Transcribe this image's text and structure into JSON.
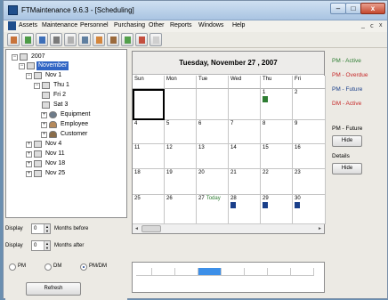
{
  "window": {
    "title": "FTMaintenance 9.6.3 - [Scheduling]"
  },
  "title_controls": {
    "minimize": "–",
    "maximize": "□",
    "close": "x"
  },
  "mdi_controls": {
    "minimize": "_",
    "restore": "ⅽ",
    "close": "x"
  },
  "menu": [
    "Assets",
    "Maintenance",
    "Personnel",
    "Purchasing",
    "Other",
    "Reports",
    "Windows",
    "Help"
  ],
  "toolbar_icons": [
    {
      "name": "work-order-icon",
      "color": "#c8733a"
    },
    {
      "name": "vendor-icon",
      "color": "#4d9b46"
    },
    {
      "name": "assets-icon",
      "color": "#3d6fb8"
    },
    {
      "name": "calendar-icon",
      "color": "#7a7a7a"
    },
    {
      "name": "inventory-icon",
      "color": "#b0b0b0"
    },
    {
      "name": "reports-icon",
      "color": "#5f7fa0"
    },
    {
      "name": "purchase-icon",
      "color": "#d4863c"
    },
    {
      "name": "people-icon",
      "color": "#9a6a3c"
    },
    {
      "name": "tools-icon",
      "color": "#53a04b"
    },
    {
      "name": "settings-icon",
      "color": "#c44f3f"
    },
    {
      "name": "help-icon",
      "color": "#cfcfcf"
    }
  ],
  "tree": {
    "year": "2007",
    "month": "November",
    "nov1": "Nov 1",
    "thu1": "Thu 1",
    "fri2": "Fri 2",
    "sat3": "Sat 3",
    "equipment": "Equipment",
    "employee": "Employee",
    "customer": "Customer",
    "nov4": "Nov 4",
    "nov11": "Nov 11",
    "nov18": "Nov 18",
    "nov25": "Nov 25",
    "expanded": "−",
    "collapsed": "+"
  },
  "months_before": {
    "label": "Display",
    "value": "0",
    "suffix": "Months before"
  },
  "months_after": {
    "label": "Display",
    "value": "0",
    "suffix": "Months after"
  },
  "filter": {
    "pm": "PM",
    "dm": "DM",
    "pmdm": "PM/DM",
    "selected": "PM/DM"
  },
  "refresh_label": "Refresh",
  "calendar": {
    "date_title": "Tuesday, November 27 , 2007",
    "days": [
      "Sun",
      "Mon",
      "Tue",
      "Wed",
      "Thu",
      "Fri"
    ],
    "today_label": "Today",
    "weeks": [
      [
        "",
        "",
        "",
        "",
        "1",
        "2"
      ],
      [
        "4",
        "5",
        "6",
        "7",
        "8",
        "9"
      ],
      [
        "11",
        "12",
        "13",
        "14",
        "15",
        "16"
      ],
      [
        "18",
        "19",
        "20",
        "21",
        "22",
        "23"
      ],
      [
        "25",
        "26",
        "27",
        "28",
        "29",
        "30"
      ]
    ],
    "scroll_left": "◄",
    "scroll_right": "►"
  },
  "legend": {
    "pm_active": "PM - Active",
    "pm_overdue": "PM - Overdue",
    "pm_future": "PM - Future",
    "dm_active": "DM - Active",
    "pm_future_section": "PM - Future",
    "details": "Details",
    "hide": "Hide",
    "colors": {
      "pm_active": "#2e7d32",
      "pm_overdue": "#c62828",
      "pm_future": "#1a3f8a",
      "dm_active": "#c62828"
    }
  }
}
